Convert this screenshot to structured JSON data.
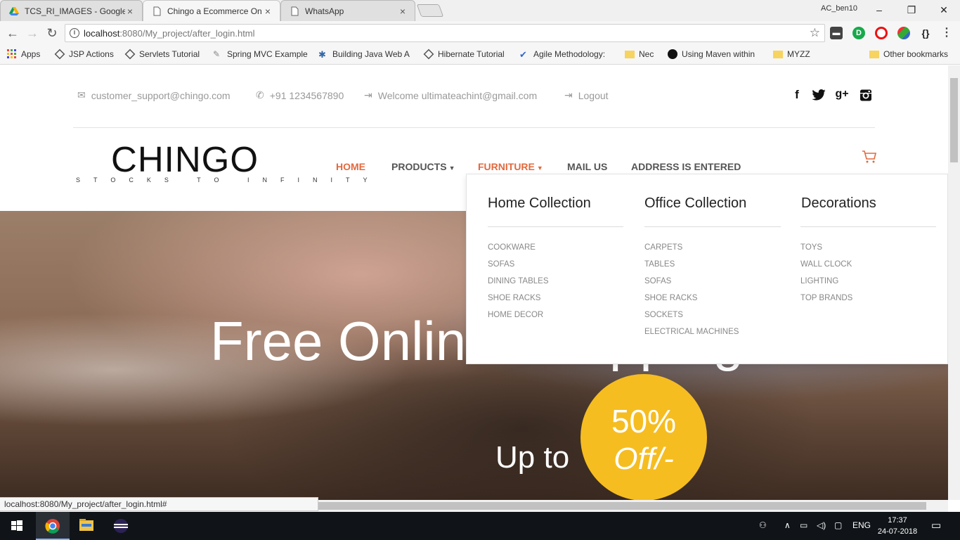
{
  "browser": {
    "tabs": [
      {
        "title": "TCS_RI_IMAGES - Google",
        "active": false
      },
      {
        "title": "Chingo a Ecommerce On",
        "active": true
      },
      {
        "title": "WhatsApp",
        "active": false
      }
    ],
    "user_label": "AC_ben10",
    "url_host": "localhost",
    "url_rest": ":8080/My_project/after_login.html",
    "bookmarks": [
      {
        "label": "Apps"
      },
      {
        "label": "JSP Actions"
      },
      {
        "label": "Servlets Tutorial"
      },
      {
        "label": "Spring MVC Example"
      },
      {
        "label": "Building Java Web A"
      },
      {
        "label": "Hibernate Tutorial"
      },
      {
        "label": "Agile Methodology:"
      },
      {
        "label": "Nec"
      },
      {
        "label": "Using Maven within"
      },
      {
        "label": "MYZZ"
      },
      {
        "label": "Other bookmarks"
      }
    ],
    "status_url": "localhost:8080/My_project/after_login.html#"
  },
  "topbar": {
    "email": "customer_support@chingo.com",
    "phone": "+91 1234567890",
    "welcome": "Welcome ultimateachint@gmail.com",
    "logout": "Logout"
  },
  "social": {
    "facebook": "f",
    "google": "g+"
  },
  "brand": {
    "name": "CHINGO",
    "tagline": "STOCKS TO INFINITY"
  },
  "menu": {
    "home": "HOME",
    "products": "PRODUCTS",
    "furniture": "FURNITURE",
    "mail": "MAIL US",
    "address": "ADDRESS IS ENTERED"
  },
  "dropdown": {
    "columns": [
      {
        "heading": "Home Collection",
        "links": [
          "COOKWARE",
          "SOFAS",
          "DINING TABLES",
          "SHOE RACKS",
          "HOME DECOR"
        ]
      },
      {
        "heading": "Office Collection",
        "links": [
          "CARPETS",
          "TABLES",
          "SOFAS",
          "SHOE RACKS",
          "SOCKETS",
          "ELECTRICAL MACHINES"
        ]
      },
      {
        "heading": "Decorations",
        "links": [
          "TOYS",
          "WALL CLOCK",
          "LIGHTING",
          "TOP BRANDS"
        ]
      }
    ]
  },
  "hero": {
    "title": "Free Online Shopping",
    "upto": "Up to",
    "badge_pct": "50%",
    "badge_off": "Off/-"
  },
  "taskbar": {
    "lang": "ENG",
    "time": "17:37",
    "date": "24-07-2018"
  },
  "colors": {
    "accent": "#e2693e",
    "badge": "#f6bd21"
  }
}
